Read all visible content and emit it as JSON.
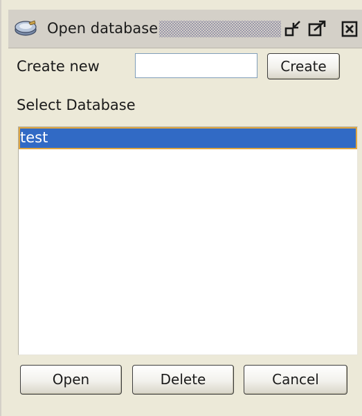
{
  "window": {
    "title": "Open database",
    "controls": {
      "minimize_icon": "restore-down-icon",
      "maximize_icon": "maximize-icon",
      "close_icon": "close-icon"
    }
  },
  "create": {
    "label": "Create new",
    "input_value": "",
    "input_placeholder": "",
    "button_label": "Create"
  },
  "select": {
    "label": "Select Database",
    "databases": [
      {
        "name": "test",
        "selected": true
      }
    ]
  },
  "actions": {
    "open_label": "Open",
    "delete_label": "Delete",
    "cancel_label": "Cancel"
  },
  "colors": {
    "selection": "#316ac5",
    "selection_outline": "#e0a640",
    "window_bg": "#ece9d8"
  }
}
